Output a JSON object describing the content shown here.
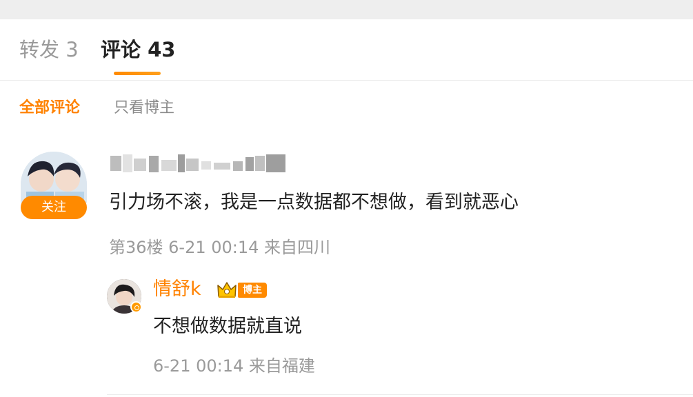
{
  "tabs": {
    "repost": "转发 3",
    "comments": "评论 43"
  },
  "filters": {
    "all": "全部评论",
    "author_only": "只看博主"
  },
  "comment": {
    "follow_label": "关注",
    "text": "引力场不滚，我是一点数据都不想做，看到就恶心",
    "meta": "第36楼 6-21 00:14 来自四川",
    "username_note": "blurred"
  },
  "reply": {
    "name": "情舒k",
    "badge": "博主",
    "text": "不想做数据就直说",
    "meta": "6-21 00:14 来自福建"
  },
  "colors": {
    "accent": "#ff8200",
    "muted": "#9a9a9a",
    "text": "#222222"
  },
  "icons": {
    "crown": "crown-icon",
    "verified": "verified-icon"
  }
}
